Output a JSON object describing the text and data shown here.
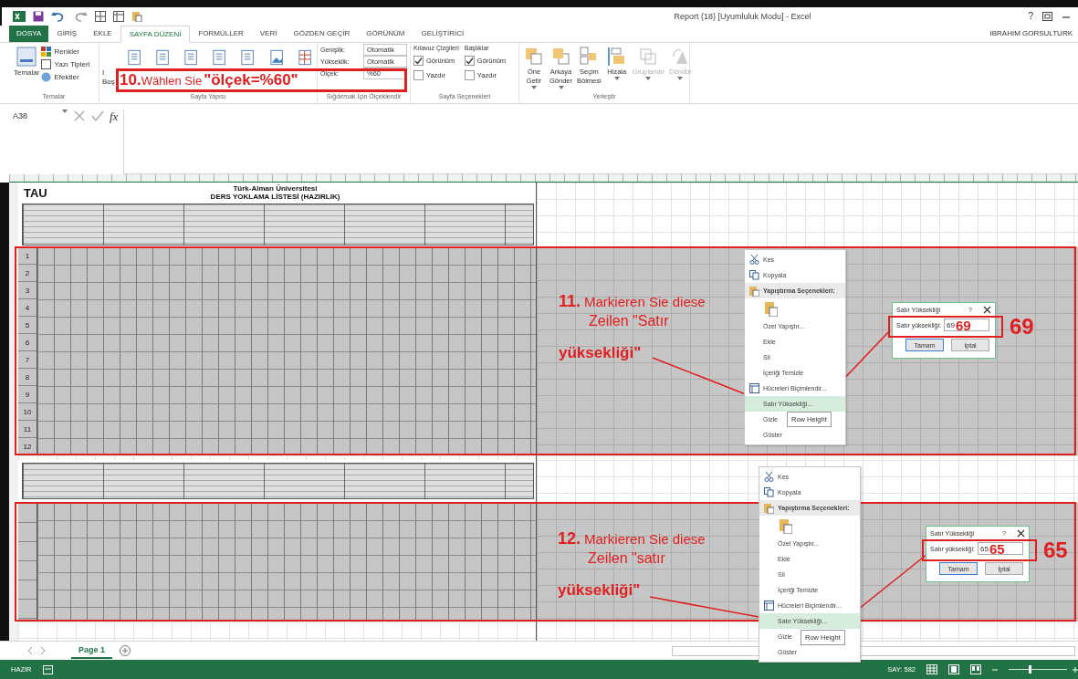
{
  "window": {
    "title": "Report (18)  [Uyumluluk Modu] - Excel",
    "help": "?"
  },
  "account": "IBRAHIM GORSULTURK",
  "tabs": [
    {
      "label": "DOSYA",
      "kind": "file",
      "selected": false
    },
    {
      "label": "GİRİŞ",
      "kind": "tab",
      "selected": false
    },
    {
      "label": "EKLE",
      "kind": "tab",
      "selected": false
    },
    {
      "label": "SAYFA DÜZENİ",
      "kind": "tab",
      "selected": true
    },
    {
      "label": "FORMÜLLER",
      "kind": "tab",
      "selected": false
    },
    {
      "label": "VERİ",
      "kind": "tab",
      "selected": false
    },
    {
      "label": "GÖZDEN GEÇİR",
      "kind": "tab",
      "selected": false
    },
    {
      "label": "GÖRÜNÜM",
      "kind": "tab",
      "selected": false
    },
    {
      "label": "GELİŞTİRİCİ",
      "kind": "tab",
      "selected": false
    }
  ],
  "ribbon": {
    "themes": {
      "button": "Temalar",
      "options": [
        "Renkler",
        "Yazı Tipleri",
        "Efektler"
      ],
      "group": "Temalar"
    },
    "page_setup": {
      "label_lines": [
        "I",
        "Boş"
      ],
      "group": "Sayfa Yapısı"
    },
    "scale": {
      "width_label": "Genişlik:",
      "width_value": "Otomatik",
      "height_label": "Yükseklik:",
      "height_value": "Otomatik",
      "scale_label": "Ölçek:",
      "scale_value": "%60",
      "group": "Sığdırmak İçin Ölçeklendir"
    },
    "sheet_options": {
      "columns": [
        {
          "title": "Kılavuz Çizgileri",
          "options": [
            {
              "label": "Görünüm",
              "checked": true
            },
            {
              "label": "Yazdır",
              "checked": false
            }
          ]
        },
        {
          "title": "Başlıklar",
          "options": [
            {
              "label": "Görünüm",
              "checked": true
            },
            {
              "label": "Yazdır",
              "checked": false
            }
          ]
        }
      ],
      "group": "Sayfa Seçenekleri"
    },
    "arrange": {
      "buttons": [
        {
          "lines": [
            "Öne",
            "Getir"
          ],
          "dropdown": true,
          "disabled": false
        },
        {
          "lines": [
            "Arkaya",
            "Gönder"
          ],
          "dropdown": true,
          "disabled": false
        },
        {
          "lines": [
            "Seçim",
            "Bölmesi"
          ],
          "dropdown": false,
          "disabled": false
        },
        {
          "lines": [
            "Hizala"
          ],
          "dropdown": true,
          "disabled": false
        },
        {
          "lines": [
            "Gruplandır"
          ],
          "dropdown": true,
          "disabled": true
        },
        {
          "lines": [
            "Döndür"
          ],
          "dropdown": true,
          "disabled": true
        }
      ],
      "group": "Yerleştir"
    }
  },
  "formula_bar": {
    "name_box": "A38",
    "function_label": "fx"
  },
  "sheet": {
    "logo": "TAU",
    "title": "Türk-Alman Üniversitesi",
    "subtitle": "DERS YOKLAMA LİSTESİ (HAZIRLIK)",
    "row_numbers": [
      "1",
      "2",
      "3",
      "4",
      "5",
      "6",
      "7",
      "8",
      "9",
      "10",
      "11",
      "12"
    ]
  },
  "sheet_tabs": [
    {
      "label": "Page 1",
      "selected": true
    }
  ],
  "status_bar": {
    "mode": "HAZIR",
    "count": "SAY: 582",
    "zoom": {
      "level": 0.35
    }
  },
  "annotations": {
    "step_10": {
      "number": "10.",
      "text": "Wählen Sie",
      "highlight": "\"ölçek=%60\""
    },
    "steps": [
      {
        "number": "11.",
        "lines": [
          "Markieren Sie diese",
          "Zeilen \"Satır",
          "yüksekliği\""
        ]
      },
      {
        "number": "12.",
        "lines": [
          "Markieren Sie diese",
          "Zeilen \"satır",
          "yüksekliği\""
        ]
      }
    ]
  },
  "context_menus": [
    {
      "tooltip": "Row Height",
      "items": [
        {
          "label": "Kes",
          "kind": "item",
          "selected": false
        },
        {
          "label": "Kopyala",
          "kind": "item",
          "selected": false
        },
        {
          "label": "Yapıştırma Seçenekleri:",
          "kind": "header"
        },
        {
          "kind": "paste"
        },
        {
          "label": "Özel Yapıştır...",
          "kind": "item",
          "selected": false
        },
        {
          "label": "Ekle",
          "kind": "item",
          "selected": false
        },
        {
          "label": "Sil",
          "kind": "item",
          "selected": false
        },
        {
          "label": "İçeriği Temizle",
          "kind": "item",
          "selected": false
        },
        {
          "label": "Hücreleri Biçimlendir...",
          "kind": "item",
          "selected": false
        },
        {
          "label": "Satır Yüksekliği...",
          "kind": "item",
          "selected": true
        },
        {
          "label": "Gizle",
          "kind": "item",
          "selected": false
        },
        {
          "label": "Göster",
          "kind": "item",
          "selected": false
        }
      ]
    },
    {
      "tooltip": "Row Height",
      "items": [
        {
          "label": "Kes",
          "kind": "item",
          "selected": false
        },
        {
          "label": "Kopyala",
          "kind": "item",
          "selected": false
        },
        {
          "label": "Yapıştırma Seçenekleri:",
          "kind": "header"
        },
        {
          "kind": "paste"
        },
        {
          "label": "Özel Yapıştır...",
          "kind": "item",
          "selected": false
        },
        {
          "label": "Ekle",
          "kind": "item",
          "selected": false
        },
        {
          "label": "Sil",
          "kind": "item",
          "selected": false
        },
        {
          "label": "İçeriği Temizle",
          "kind": "item",
          "selected": false
        },
        {
          "label": "Hücreleri Biçimlendir...",
          "kind": "item",
          "selected": false
        },
        {
          "label": "Satır Yüksekliği...",
          "kind": "item",
          "selected": true
        },
        {
          "label": "Gizle",
          "kind": "item",
          "selected": false
        },
        {
          "label": "Göster",
          "kind": "item",
          "selected": false
        }
      ]
    }
  ],
  "dialogs": [
    {
      "title": "Satır Yüksekliği",
      "help": "?",
      "label": "Satır yüksekliği:",
      "value": "69",
      "field_callout": "69",
      "side_callout": "69",
      "ok": "Tamam",
      "cancel": "İptal"
    },
    {
      "title": "Satır Yüksekliği",
      "help": "?",
      "label": "Satır yüksekliği:",
      "value": "65",
      "field_callout": "65",
      "side_callout": "65",
      "ok": "Tamam",
      "cancel": "İptal"
    }
  ]
}
